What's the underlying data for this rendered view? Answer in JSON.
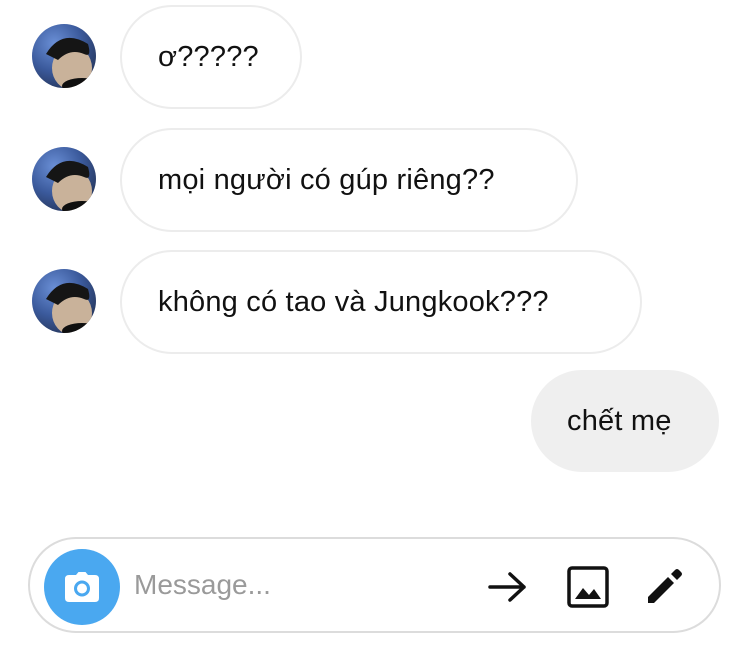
{
  "messages": [
    {
      "from": "other",
      "text": "ơ?????",
      "avatar": "user-avatar"
    },
    {
      "from": "other",
      "text": "mọi người có gúp riêng??",
      "avatar": "user-avatar"
    },
    {
      "from": "other",
      "text": "không có tao và Jungkook???",
      "avatar": "user-avatar"
    },
    {
      "from": "me",
      "text": "chết mẹ"
    }
  ],
  "composer": {
    "placeholder": "Message...",
    "value": "",
    "camera_icon": "camera-icon",
    "actions": [
      "arrow-right-icon",
      "image-icon",
      "pencil-icon"
    ]
  },
  "colors": {
    "camera_button": "#4aa8f0",
    "outgoing_bubble": "#efefef",
    "incoming_border": "#ececec"
  }
}
